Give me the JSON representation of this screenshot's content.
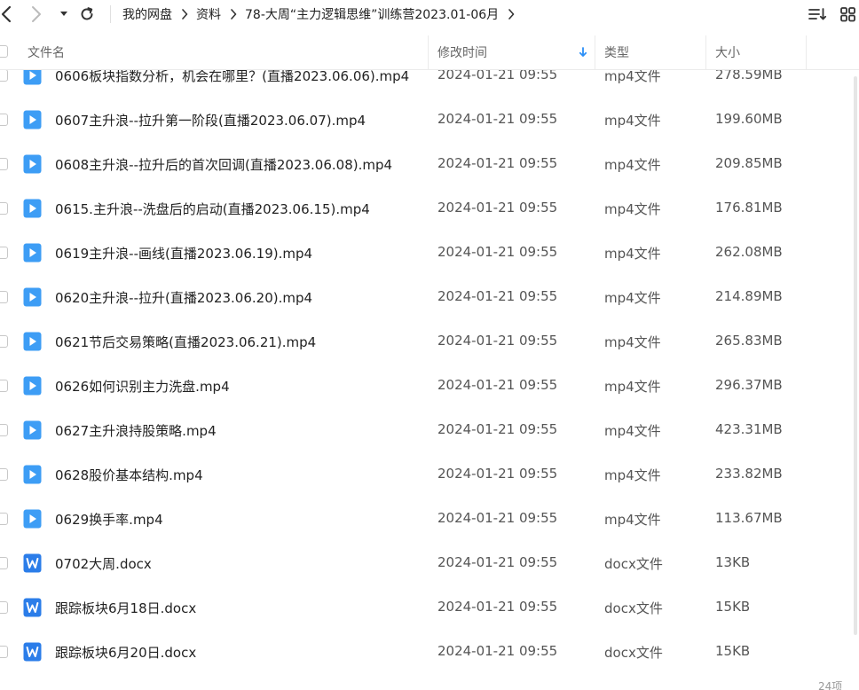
{
  "breadcrumb": [
    "我的网盘",
    "资料",
    "78-大周“主力逻辑思维”训练营2023.01-06月"
  ],
  "columns": {
    "name": "文件名",
    "date": "修改时间",
    "type": "类型",
    "size": "大小"
  },
  "files": [
    {
      "name": "0606板块指数分析，机会在哪里？(直播2023.06.06).mp4",
      "date": "2024-01-21 09:55",
      "type": "mp4文件",
      "size": "278.59MB",
      "icon": "video-file-icon"
    },
    {
      "name": "0607主升浪--拉升第一阶段(直播2023.06.07).mp4",
      "date": "2024-01-21 09:55",
      "type": "mp4文件",
      "size": "199.60MB",
      "icon": "video-file-icon"
    },
    {
      "name": "0608主升浪--拉升后的首次回调(直播2023.06.08).mp4",
      "date": "2024-01-21 09:55",
      "type": "mp4文件",
      "size": "209.85MB",
      "icon": "video-file-icon"
    },
    {
      "name": "0615.主升浪--洗盘后的启动(直播2023.06.15).mp4",
      "date": "2024-01-21 09:55",
      "type": "mp4文件",
      "size": "176.81MB",
      "icon": "video-file-icon"
    },
    {
      "name": "0619主升浪--画线(直播2023.06.19).mp4",
      "date": "2024-01-21 09:55",
      "type": "mp4文件",
      "size": "262.08MB",
      "icon": "video-file-icon"
    },
    {
      "name": "0620主升浪--拉升(直播2023.06.20).mp4",
      "date": "2024-01-21 09:55",
      "type": "mp4文件",
      "size": "214.89MB",
      "icon": "video-file-icon"
    },
    {
      "name": "0621节后交易策略(直播2023.06.21).mp4",
      "date": "2024-01-21 09:55",
      "type": "mp4文件",
      "size": "265.83MB",
      "icon": "video-file-icon"
    },
    {
      "name": "0626如何识别主力洗盘.mp4",
      "date": "2024-01-21 09:55",
      "type": "mp4文件",
      "size": "296.37MB",
      "icon": "video-file-icon"
    },
    {
      "name": "0627主升浪持股策略.mp4",
      "date": "2024-01-21 09:55",
      "type": "mp4文件",
      "size": "423.31MB",
      "icon": "video-file-icon"
    },
    {
      "name": "0628股价基本结构.mp4",
      "date": "2024-01-21 09:55",
      "type": "mp4文件",
      "size": "233.82MB",
      "icon": "video-file-icon"
    },
    {
      "name": "0629换手率.mp4",
      "date": "2024-01-21 09:55",
      "type": "mp4文件",
      "size": "113.67MB",
      "icon": "video-file-icon"
    },
    {
      "name": "0702大周.docx",
      "date": "2024-01-21 09:55",
      "type": "docx文件",
      "size": "13KB",
      "icon": "word-doc-icon"
    },
    {
      "name": "跟踪板块6月18日.docx",
      "date": "2024-01-21 09:55",
      "type": "docx文件",
      "size": "15KB",
      "icon": "word-doc-icon"
    },
    {
      "name": "跟踪板块6月20日.docx",
      "date": "2024-01-21 09:55",
      "type": "docx文件",
      "size": "15KB",
      "icon": "word-doc-icon"
    }
  ],
  "footer": {
    "item_count": "24项"
  },
  "colors": {
    "video_icon": "#3d9df5",
    "doc_icon": "#2b7de9",
    "sort_arrow": "#2b8ff7",
    "nav_active": "#333333",
    "nav_disabled": "#bbbbbb"
  }
}
